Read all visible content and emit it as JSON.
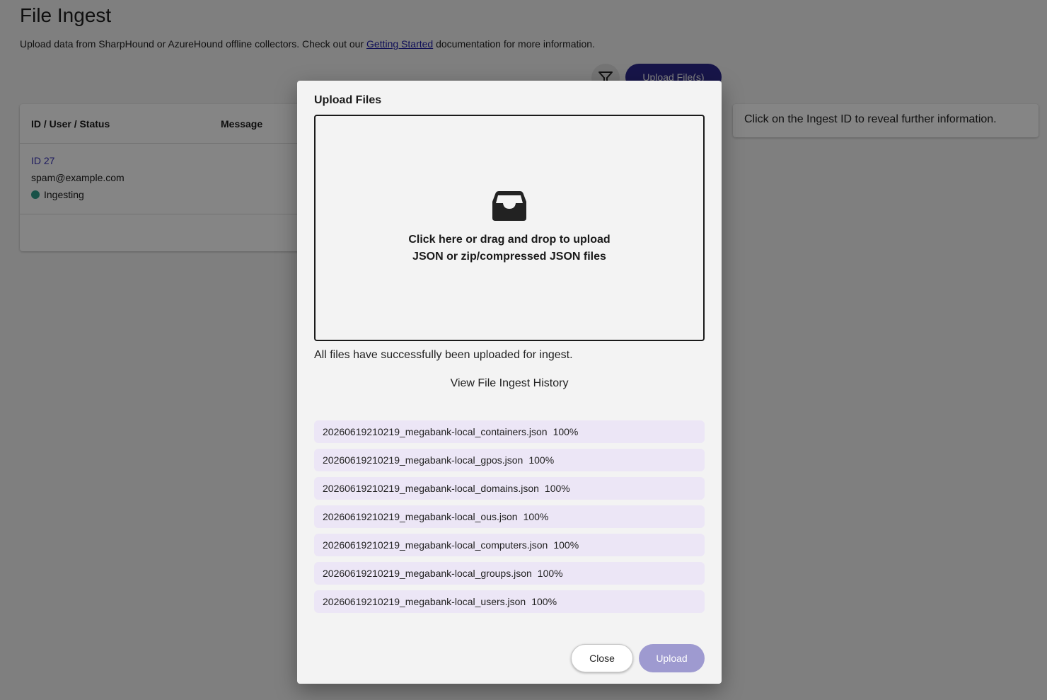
{
  "page": {
    "title": "File Ingest",
    "description_before": "Upload data from SharpHound or AzureHound offline collectors. Check out our ",
    "description_link": "Getting Started",
    "description_after": " documentation for more information.",
    "filter_icon": "filter-icon",
    "upload_button_label": "Upload File(s)"
  },
  "table": {
    "columns": [
      "ID / User / Status",
      "Message"
    ],
    "rows": [
      {
        "id": "ID 27",
        "user": "spam@example.com",
        "status": "Ingesting",
        "status_color": "#2e9e8a"
      }
    ]
  },
  "info_panel": {
    "text": "Click on the Ingest ID to reveal further information."
  },
  "dialog": {
    "title": "Upload Files",
    "dropzone_icon": "inbox-icon",
    "dropzone_line1": "Click here or drag and drop to upload",
    "dropzone_line2": "JSON or zip/compressed JSON files",
    "success_message": "All files have successfully been uploaded for ingest.",
    "history_link": "View File Ingest History",
    "files": [
      {
        "name": "20260619210219_megabank-local_containers.json",
        "progress": "100%"
      },
      {
        "name": "20260619210219_megabank-local_gpos.json",
        "progress": "100%"
      },
      {
        "name": "20260619210219_megabank-local_domains.json",
        "progress": "100%"
      },
      {
        "name": "20260619210219_megabank-local_ous.json",
        "progress": "100%"
      },
      {
        "name": "20260619210219_megabank-local_computers.json",
        "progress": "100%"
      },
      {
        "name": "20260619210219_megabank-local_groups.json",
        "progress": "100%"
      },
      {
        "name": "20260619210219_megabank-local_users.json",
        "progress": "100%"
      }
    ],
    "close_label": "Close",
    "upload_label": "Upload"
  },
  "colors": {
    "primary": "#2d2a8c",
    "primary_disabled": "#9e9ad0",
    "file_item_bg": "#ece6f6",
    "link": "#1a1aa6"
  }
}
